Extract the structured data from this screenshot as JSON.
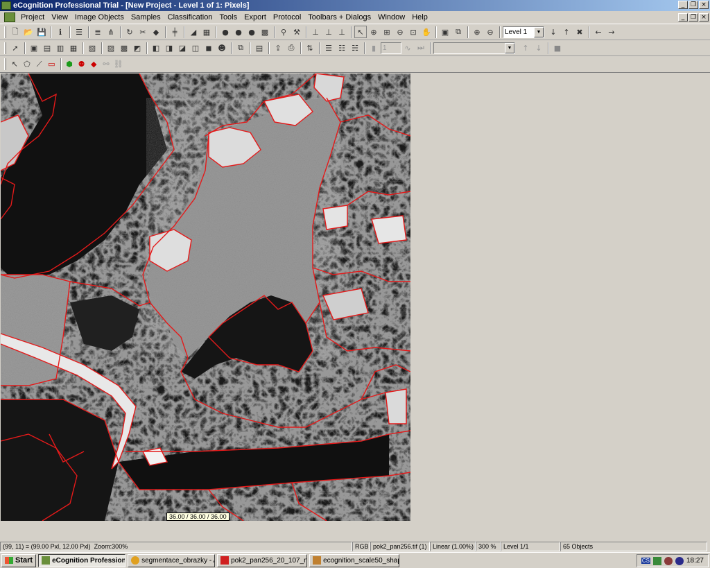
{
  "window": {
    "title": "eCognition Professional Trial - [New Project - Level 1 of 1: Pixels]"
  },
  "menu": [
    "Project",
    "View",
    "Image Objects",
    "Samples",
    "Classification",
    "Tools",
    "Export",
    "Protocol",
    "Toolbars + Dialogs",
    "Window",
    "Help"
  ],
  "toolbar": {
    "level_value": "Level 1",
    "disabled_field_value": "1"
  },
  "viewer": {
    "tooltip": "36.00 / 36.00 / 36.00"
  },
  "status": {
    "position": "(99, 11) = (99.00 Pxl, 12.00 Pxl)",
    "zoom": "Zoom:300%",
    "mode": "RGB",
    "layer": "pok2_pan256.tif (1)",
    "stretch": "Linear (1.00%)",
    "percent": "300 %",
    "level": "Level 1/1",
    "objects": "65 Objects"
  },
  "taskbar": {
    "start": "Start",
    "tasks": [
      "eCognition Profession...",
      "segmentace_obrazky - A...",
      "pok2_pan256_20_107_n...",
      "ecognition_scale50_shap..."
    ],
    "clock": "18:27",
    "tray_lang": "CS"
  },
  "colors": {
    "segment_outline": "#e41a1a",
    "titlebar_start": "#0a246a",
    "titlebar_end": "#a6caf0"
  }
}
